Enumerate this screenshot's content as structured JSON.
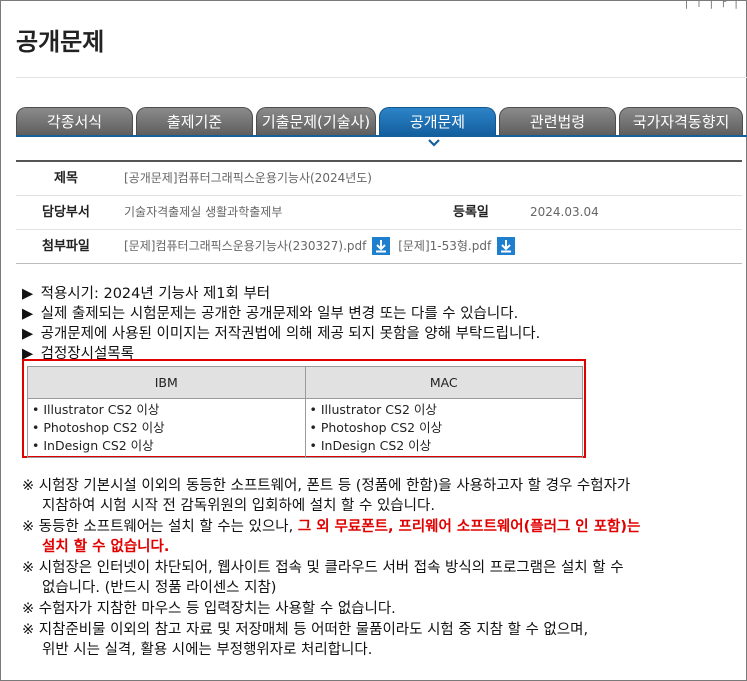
{
  "page": {
    "title": "공개문제"
  },
  "tabs": [
    {
      "label": "각종서식",
      "active": false
    },
    {
      "label": "출제기준",
      "active": false
    },
    {
      "label": "기출문제(기술사)",
      "active": false
    },
    {
      "label": "공개문제",
      "active": true
    },
    {
      "label": "관련법령",
      "active": false
    },
    {
      "label": "국가자격동향지",
      "active": false
    }
  ],
  "info": {
    "subject_label": "제목",
    "subject_value": "[공개문제]컴퓨터그래픽스운용기능사(2024년도)",
    "dept_label": "담당부서",
    "dept_value": "기술자격출제실 생활과학출제부",
    "date_label": "등록일",
    "date_value": "2024.03.04",
    "files_label": "첨부파일",
    "file1": "[문제]컴퓨터그래픽스운용기능사(230327).pdf",
    "file2": "[문제]1-53형.pdf"
  },
  "notes": [
    "적용시기: 2024년 기능사 제1회 부터",
    "실제 출제되는 시험문제는 공개한 공개문제와 일부 변경 또는 다를 수 있습니다.",
    "공개문제에 사용된 이미지는 저작권법에 의해 제공 되지 못함을 양해 부탁드립니다.",
    "검정장시설목록"
  ],
  "env_table": {
    "headers": [
      "IBM",
      "MAC"
    ],
    "ibm": [
      "• Illustrator CS2 이상",
      "• Photoshop CS2 이상",
      "• InDesign CS2 이상"
    ],
    "mac": [
      "• Illustrator CS2 이상",
      "• Photoshop CS2 이상",
      "• InDesign CS2 이상"
    ]
  },
  "warnings": {
    "w1a": "※ 시험장 기본시설 이외의 동등한 소프트웨어, 폰트 등 (정품에 한함)을 사용하고자 할 경우 수험자가",
    "w1b": "지참하여 시험 시작 전 감독위원의 입회하에 설치 할 수 있습니다.",
    "w2a": "※  동등한 소프트웨어는 설치 할 수는 있으나, ",
    "w2red": "그 외 무료폰트, 프리웨어 소프트웨어(플러그 인 포함)는",
    "w2b": "설치 할 수 없습니다.",
    "w3a": "※ 시험장은 인터넷이 차단되어, 웹사이트 접속 및 클라우드 서버 접속 방식의 프로그램은 설치 할 수",
    "w3b": "없습니다.  (반드시 정품 라이센스 지참)",
    "w4": "※ 수험자가 지참한 마우스 등 입력장치는 사용할 수 없습니다.",
    "w5a": "※ 지참준비물 이외의 참고 자료 및 저장매체 등 어떠한 물품이라도 시험 중 지참 할 수 없으며,",
    "w5b": "위반 시는  실격, 활용 시에는 부정행위자로 처리합니다."
  },
  "colors": {
    "active_tab": "#1d6fb5",
    "inactive_tab": "#707070",
    "highlight": "#e00000"
  },
  "icons": {
    "download": "download-icon",
    "caret": "chevron-down-icon"
  }
}
